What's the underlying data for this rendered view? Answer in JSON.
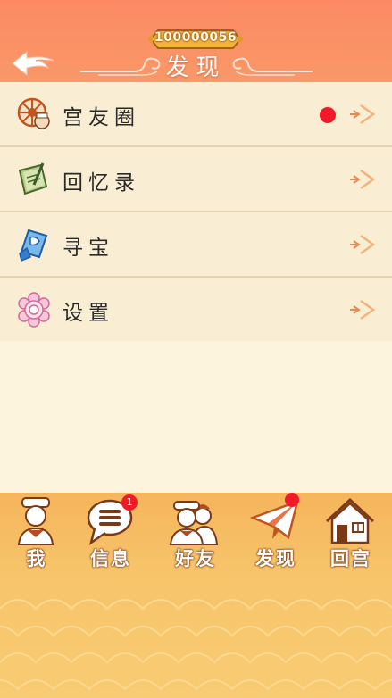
{
  "header": {
    "coins": "100000056",
    "title": "发现"
  },
  "menu": [
    {
      "label": "宫友圈",
      "icon": "wheel-icon",
      "has_dot": true
    },
    {
      "label": "回忆录",
      "icon": "book-icon",
      "has_dot": false
    },
    {
      "label": "寻宝",
      "icon": "treasure-icon",
      "has_dot": false
    },
    {
      "label": "设置",
      "icon": "flower-gear-icon",
      "has_dot": false
    }
  ],
  "tabs": [
    {
      "label": "我",
      "icon": "person-icon"
    },
    {
      "label": "信息",
      "icon": "message-bubble-icon",
      "badge": "1"
    },
    {
      "label": "好友",
      "icon": "friends-icon"
    },
    {
      "label": "发现",
      "icon": "paper-plane-icon",
      "dot": true
    },
    {
      "label": "回宫",
      "icon": "house-icon"
    }
  ],
  "colors": {
    "header": "#fb8a63",
    "list_bg": "#f9eed3",
    "tabbar": "#f5b55c",
    "red": "#f01a28"
  }
}
